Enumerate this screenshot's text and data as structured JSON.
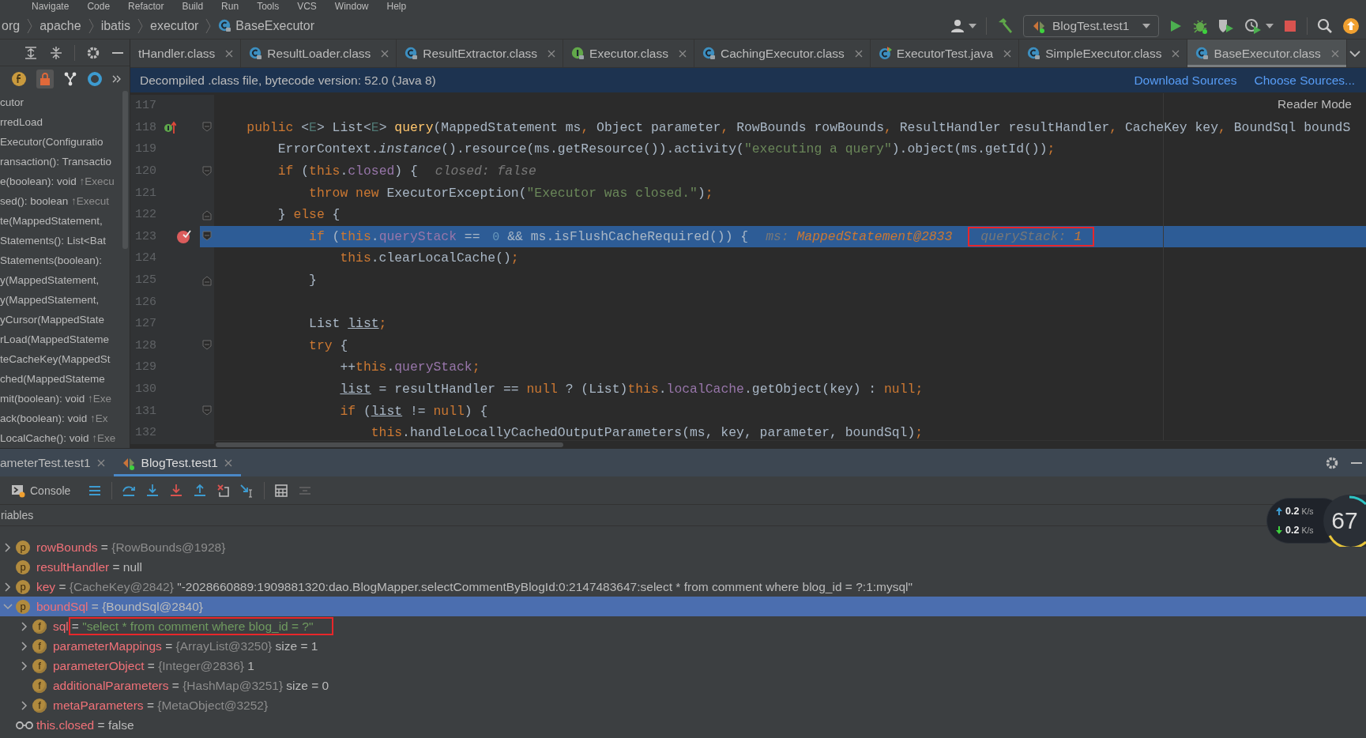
{
  "menu": [
    "Navigate",
    "Code",
    "Refactor",
    "Build",
    "Run",
    "Tools",
    "VCS",
    "Window",
    "Help"
  ],
  "breadcrumbs": [
    {
      "label": "org",
      "kind": "package"
    },
    {
      "label": "apache",
      "kind": "package"
    },
    {
      "label": "ibatis",
      "kind": "package"
    },
    {
      "label": "executor",
      "kind": "package"
    },
    {
      "label": "BaseExecutor",
      "kind": "class"
    }
  ],
  "run_config": {
    "label": "BlogTest.test1"
  },
  "editor_tabs": [
    {
      "label": "tHandler.class",
      "kind": "none",
      "selected": false
    },
    {
      "label": "ResultLoader.class",
      "kind": "class",
      "selected": false
    },
    {
      "label": "ResultExtractor.class",
      "kind": "class",
      "selected": false
    },
    {
      "label": "Executor.class",
      "kind": "interface",
      "selected": false
    },
    {
      "label": "CachingExecutor.class",
      "kind": "class",
      "selected": false
    },
    {
      "label": "ExecutorTest.java",
      "kind": "test",
      "selected": false
    },
    {
      "label": "SimpleExecutor.class",
      "kind": "class",
      "selected": false
    },
    {
      "label": "BaseExecutor.class",
      "kind": "class",
      "selected": true
    }
  ],
  "banner": {
    "message": "Decompiled .class file, bytecode version: 52.0 (Java 8)",
    "links": [
      "Download Sources",
      "Choose Sources..."
    ]
  },
  "structure": {
    "items": [
      {
        "text": "cutor"
      },
      {
        "text": "rredLoad"
      },
      {
        "text": "Executor(Configuratio"
      },
      {
        "text": "ransaction(): Transactio"
      },
      {
        "text": "e(boolean): void",
        "origin": "↑Execu"
      },
      {
        "text": "sed(): boolean",
        "origin": "↑Execut"
      },
      {
        "text": "te(MappedStatement,"
      },
      {
        "text": "Statements(): List<Bat"
      },
      {
        "text": "Statements(boolean):"
      },
      {
        "text": "y(MappedStatement,"
      },
      {
        "text": "y(MappedStatement,"
      },
      {
        "text": "yCursor(MappedState"
      },
      {
        "text": "rLoad(MappedStateme"
      },
      {
        "text": "teCacheKey(MappedSt"
      },
      {
        "text": "ched(MappedStateme"
      },
      {
        "text": "mit(boolean): void",
        "origin": "↑Exe"
      },
      {
        "text": "ack(boolean): void",
        "origin": "↑Ex"
      },
      {
        "text": "LocalCache(): void",
        "origin": "↑Exe"
      }
    ]
  },
  "editor": {
    "reader_mode": "Reader Mode",
    "lines": [
      {
        "number": "117",
        "current": false
      },
      {
        "number": "118",
        "current": false,
        "marker": {
          "kind": "implements"
        },
        "fold": {
          "kind": "open"
        },
        "tokens": [
          {
            "kind": "kw",
            "text": "    public"
          },
          {
            "kind": "plain",
            "text": " <"
          },
          {
            "kind": "tparam",
            "text": "E"
          },
          {
            "kind": "plain",
            "text": "> List<"
          },
          {
            "kind": "tparam",
            "text": "E"
          },
          {
            "kind": "plain",
            "text": "> "
          },
          {
            "kind": "decl",
            "text": "query"
          },
          {
            "kind": "plain",
            "text": "(MappedStatement ms"
          },
          {
            "kind": "kw",
            "text": ","
          },
          {
            "kind": "plain",
            "text": " Object parameter"
          },
          {
            "kind": "kw",
            "text": ","
          },
          {
            "kind": "plain",
            "text": " RowBounds rowBounds"
          },
          {
            "kind": "kw",
            "text": ","
          },
          {
            "kind": "plain",
            "text": " ResultHandler resultHandler"
          },
          {
            "kind": "kw",
            "text": ","
          },
          {
            "kind": "plain",
            "text": " CacheKey key"
          },
          {
            "kind": "kw",
            "text": ","
          },
          {
            "kind": "plain",
            "text": " BoundSql boundS"
          }
        ]
      },
      {
        "number": "119",
        "current": false,
        "tokens": [
          {
            "kind": "plain",
            "text": "        ErrorContext."
          },
          {
            "kind": "italic",
            "text": "instance"
          },
          {
            "kind": "plain",
            "text": "().resource(ms.getResource()).activity("
          },
          {
            "kind": "str",
            "text": "\"executing a query\""
          },
          {
            "kind": "plain",
            "text": ").object(ms.getId())"
          },
          {
            "kind": "kw",
            "text": ";"
          }
        ]
      },
      {
        "number": "120",
        "current": false,
        "fold": {
          "kind": "open"
        },
        "tokens": [
          {
            "kind": "kw",
            "text": "        if"
          },
          {
            "kind": "plain",
            "text": " ("
          },
          {
            "kind": "kw",
            "text": "this"
          },
          {
            "kind": "plain",
            "text": "."
          },
          {
            "kind": "field",
            "text": "closed"
          },
          {
            "kind": "plain",
            "text": ") {"
          }
        ],
        "hints": [
          {
            "label": "closed: ",
            "value": "false",
            "changed": false,
            "boxed": false
          }
        ]
      },
      {
        "number": "121",
        "current": false,
        "tokens": [
          {
            "kind": "kw",
            "text": "            throw new"
          },
          {
            "kind": "plain",
            "text": " ExecutorException("
          },
          {
            "kind": "str",
            "text": "\"Executor was closed.\""
          },
          {
            "kind": "plain",
            "text": ")"
          },
          {
            "kind": "kw",
            "text": ";"
          }
        ]
      },
      {
        "number": "122",
        "current": false,
        "fold": {
          "kind": "close"
        },
        "tokens": [
          {
            "kind": "plain",
            "text": "        } "
          },
          {
            "kind": "kw",
            "text": "else"
          },
          {
            "kind": "plain",
            "text": " {"
          }
        ]
      },
      {
        "number": "123",
        "current": true,
        "marker": {
          "kind": "breakpoint"
        },
        "fold": {
          "kind": "open"
        },
        "tokens": [
          {
            "kind": "kw",
            "text": "            if"
          },
          {
            "kind": "plain",
            "text": " ("
          },
          {
            "kind": "kw",
            "text": "this"
          },
          {
            "kind": "plain",
            "text": "."
          },
          {
            "kind": "field",
            "text": "queryStack"
          },
          {
            "kind": "plain",
            "text": " == "
          },
          {
            "kind": "num",
            "text": "0"
          },
          {
            "kind": "plain",
            "text": " && ms.isFlushCacheRequired()) {"
          }
        ],
        "hints": [
          {
            "label": "ms: ",
            "value": "MappedStatement@2833",
            "changed": true,
            "boxed": false
          },
          {
            "label": "queryStack: ",
            "value": "1",
            "changed": true,
            "boxed": true
          }
        ]
      },
      {
        "number": "124",
        "current": false,
        "tokens": [
          {
            "kind": "kw",
            "text": "                this"
          },
          {
            "kind": "plain",
            "text": ".clearLocalCache()"
          },
          {
            "kind": "kw",
            "text": ";"
          }
        ]
      },
      {
        "number": "125",
        "current": false,
        "fold": {
          "kind": "close"
        },
        "tokens": [
          {
            "kind": "plain",
            "text": "            }"
          }
        ]
      },
      {
        "number": "126",
        "current": false
      },
      {
        "number": "127",
        "current": false,
        "tokens": [
          {
            "kind": "plain",
            "text": "            List "
          },
          {
            "kind": "local",
            "text": "list"
          },
          {
            "kind": "kw",
            "text": ";"
          }
        ]
      },
      {
        "number": "128",
        "current": false,
        "fold": {
          "kind": "open"
        },
        "tokens": [
          {
            "kind": "kw",
            "text": "            try"
          },
          {
            "kind": "plain",
            "text": " {"
          }
        ]
      },
      {
        "number": "129",
        "current": false,
        "tokens": [
          {
            "kind": "plain",
            "text": "                ++"
          },
          {
            "kind": "kw",
            "text": "this"
          },
          {
            "kind": "plain",
            "text": "."
          },
          {
            "kind": "field",
            "text": "queryStack"
          },
          {
            "kind": "kw",
            "text": ";"
          }
        ]
      },
      {
        "number": "130",
        "current": false,
        "tokens": [
          {
            "kind": "local",
            "text": "                list"
          },
          {
            "kind": "plain",
            "text": " = resultHandler == "
          },
          {
            "kind": "kw",
            "text": "null"
          },
          {
            "kind": "plain",
            "text": " ? (List)"
          },
          {
            "kind": "kw",
            "text": "this"
          },
          {
            "kind": "plain",
            "text": "."
          },
          {
            "kind": "field",
            "text": "localCache"
          },
          {
            "kind": "plain",
            "text": ".getObject(key) : "
          },
          {
            "kind": "kw",
            "text": "null;"
          }
        ]
      },
      {
        "number": "131",
        "current": false,
        "fold": {
          "kind": "open"
        },
        "tokens": [
          {
            "kind": "kw",
            "text": "                if"
          },
          {
            "kind": "plain",
            "text": " ("
          },
          {
            "kind": "local",
            "text": "list"
          },
          {
            "kind": "plain",
            "text": " != "
          },
          {
            "kind": "kw",
            "text": "null"
          },
          {
            "kind": "plain",
            "text": ") {"
          }
        ]
      },
      {
        "number": "132",
        "current": false,
        "tokens": [
          {
            "kind": "kw",
            "text": "                    this"
          },
          {
            "kind": "plain",
            "text": ".handleLocallyCachedOutputParameters(ms, key, parameter, boundSql)"
          },
          {
            "kind": "kw",
            "text": ";"
          }
        ]
      }
    ]
  },
  "debug": {
    "tabs": [
      {
        "label": "ameterTest.test1",
        "selected": false,
        "kind": "none"
      },
      {
        "label": "BlogTest.test1",
        "selected": true,
        "kind": "run"
      }
    ],
    "console": "Console",
    "variables_header": "riables",
    "variables": [
      {
        "badge": "p",
        "kind": "param",
        "expanded": false,
        "selected": false,
        "segments": [
          {
            "kind": "name",
            "text": "rowBounds"
          },
          {
            "kind": "op",
            "text": " = "
          },
          {
            "kind": "type",
            "text": "{RowBounds@1928}"
          }
        ]
      },
      {
        "badge": "p",
        "kind": "param",
        "selected": false,
        "segments": [
          {
            "kind": "name",
            "text": "resultHandler"
          },
          {
            "kind": "op",
            "text": " = null"
          }
        ]
      },
      {
        "badge": "p",
        "kind": "param",
        "expanded": false,
        "selected": false,
        "segments": [
          {
            "kind": "name",
            "text": "key"
          },
          {
            "kind": "op",
            "text": " = "
          },
          {
            "kind": "type",
            "text": "{CacheKey@2842}"
          },
          {
            "kind": "op",
            "text": " \"-2028660889:1909881320:dao.BlogMapper.selectCommentByBlogId:0:2147483647:select * from comment where blog_id = ?:1:mysql\""
          }
        ]
      },
      {
        "badge": "p",
        "kind": "param",
        "expanded": true,
        "selected": true,
        "segments": [
          {
            "kind": "name",
            "text": "boundSql"
          },
          {
            "kind": "op",
            "text": " = "
          },
          {
            "kind": "op",
            "text": "{BoundSql@2840}"
          }
        ],
        "children": [
          {
            "badge": "f",
            "kind": "field",
            "expanded": false,
            "selected": false,
            "segments": [
              {
                "kind": "name",
                "text": "sql"
              },
              {
                "kind": "box",
                "segments": [
                  {
                    "kind": "op",
                    "text": "= "
                  },
                  {
                    "kind": "str",
                    "text": "\"select * from comment where blog_id = ?\""
                  }
                ]
              }
            ]
          },
          {
            "badge": "f",
            "kind": "field",
            "expanded": false,
            "selected": false,
            "segments": [
              {
                "kind": "name",
                "text": "parameterMappings"
              },
              {
                "kind": "op",
                "text": " = "
              },
              {
                "kind": "type",
                "text": "{ArrayList@3250}"
              },
              {
                "kind": "op",
                "text": "  size = 1"
              }
            ]
          },
          {
            "badge": "f",
            "kind": "field",
            "expanded": false,
            "selected": false,
            "segments": [
              {
                "kind": "name",
                "text": "parameterObject"
              },
              {
                "kind": "op",
                "text": " = "
              },
              {
                "kind": "type",
                "text": "{Integer@2836}"
              },
              {
                "kind": "op",
                "text": " 1"
              }
            ]
          },
          {
            "badge": "f",
            "kind": "field",
            "selected": false,
            "segments": [
              {
                "kind": "name",
                "text": "additionalParameters"
              },
              {
                "kind": "op",
                "text": " = "
              },
              {
                "kind": "type",
                "text": "{HashMap@3251}"
              },
              {
                "kind": "op",
                "text": "  size = 0"
              }
            ]
          },
          {
            "badge": "f",
            "kind": "field",
            "expanded": false,
            "selected": false,
            "segments": [
              {
                "kind": "name",
                "text": "metaParameters"
              },
              {
                "kind": "op",
                "text": " = "
              },
              {
                "kind": "type",
                "text": "{MetaObject@3252}"
              }
            ]
          }
        ]
      },
      {
        "kind": "watch",
        "selected": false,
        "segments": [
          {
            "kind": "name",
            "text": "this.closed"
          },
          {
            "kind": "op",
            "text": " = false"
          }
        ]
      }
    ]
  },
  "network": {
    "upload": "0.2",
    "upload_unit": "K/s",
    "download": "0.2",
    "download_unit": "K/s",
    "gauge": "67"
  }
}
